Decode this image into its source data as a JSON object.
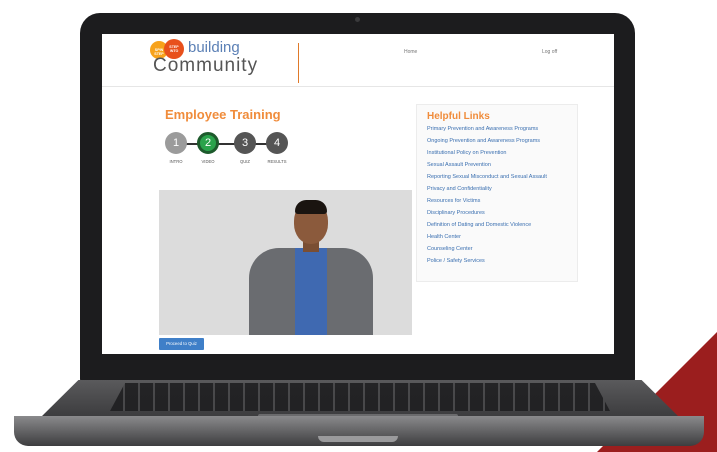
{
  "header": {
    "logo": {
      "circle_1_text": "SPIN STEP",
      "circle_2_text": "STEP INTO",
      "word_1": "building",
      "word_2": "Community"
    },
    "nav": {
      "home": "Home",
      "logoff": "Log off"
    }
  },
  "main": {
    "title": "Employee Training",
    "steps": [
      {
        "number": "1",
        "label": "INTRO",
        "state": "done"
      },
      {
        "number": "2",
        "label": "VIDEO",
        "state": "active"
      },
      {
        "number": "3",
        "label": "QUIZ",
        "state": "pending"
      },
      {
        "number": "4",
        "label": "RESULTS",
        "state": "pending"
      }
    ],
    "proceed_button": "Proceed to Quiz"
  },
  "sidebar": {
    "title": "Helpful Links",
    "links": [
      "Primary Prevention and Awareness Programs",
      "Ongoing Prevention and Awareness Programs",
      "Institutional Policy on Prevention",
      "Sexual Assault Prevention",
      "Reporting Sexual Misconduct and Sexual Assault",
      "Privacy and Confidentiality",
      "Resources for Victims",
      "Disciplinary Procedures",
      "Definition of Dating and Domestic Violence",
      "Health Center",
      "Counseling Center",
      "Police / Safety Services"
    ]
  },
  "colors": {
    "accent_orange": "#f08c3b",
    "active_step": "#2aa34b",
    "link_blue": "#3a6fb0",
    "button_blue": "#3f7fc8",
    "corner_red": "#9b1e1e"
  }
}
